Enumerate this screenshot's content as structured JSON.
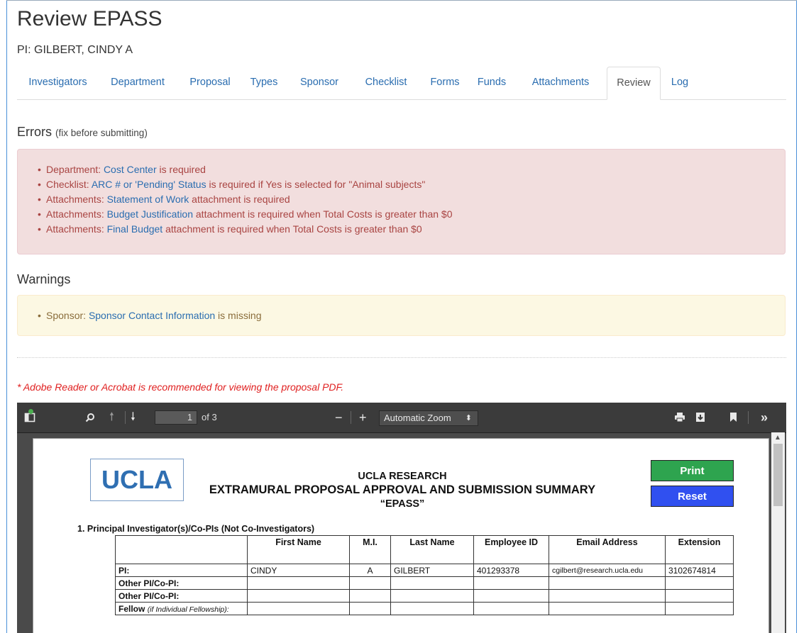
{
  "header": {
    "title": "Review EPASS",
    "pi_line": "PI: GILBERT, CINDY A"
  },
  "tabs": [
    {
      "label": "Investigators"
    },
    {
      "label": "Department"
    },
    {
      "label": "Proposal"
    },
    {
      "label": "Types"
    },
    {
      "label": "Sponsor"
    },
    {
      "label": "Checklist"
    },
    {
      "label": "Forms"
    },
    {
      "label": "Funds"
    },
    {
      "label": "Attachments"
    },
    {
      "label": "Review",
      "active": true
    },
    {
      "label": "Log"
    }
  ],
  "errors": {
    "heading": "Errors",
    "subheading": "(fix before submitting)",
    "items": [
      {
        "prefix": "Department: ",
        "link": "Cost Center",
        "suffix": " is required"
      },
      {
        "prefix": "Checklist: ",
        "link": "ARC # or 'Pending' Status",
        "suffix": " is required if Yes is selected for \"Animal subjects\""
      },
      {
        "prefix": "Attachments: ",
        "link": "Statement of Work",
        "suffix": " attachment is required"
      },
      {
        "prefix": "Attachments: ",
        "link": "Budget Justification",
        "suffix": " attachment is required when Total Costs is greater than $0"
      },
      {
        "prefix": "Attachments: ",
        "link": "Final Budget",
        "suffix": " attachment is required when Total Costs is greater than $0"
      }
    ]
  },
  "warnings": {
    "heading": "Warnings",
    "items": [
      {
        "prefix": "Sponsor: ",
        "link": "Sponsor Contact Information",
        "suffix": " is missing"
      }
    ]
  },
  "pdf_note": "* Adobe Reader or Acrobat is recommended for viewing the proposal PDF.",
  "viewer": {
    "page_number": "1",
    "page_of": "of 3",
    "zoom": "Automatic Zoom",
    "icons": {
      "sidebar": "sidebar-toggle-icon",
      "search": "search-icon",
      "prev": "arrow-up-icon",
      "next": "arrow-down-icon",
      "zoom_out": "minus-icon",
      "zoom_in": "plus-icon",
      "print": "print-icon",
      "download": "download-icon",
      "bookmark": "bookmark-icon",
      "more": "double-chevron-right-icon"
    }
  },
  "document": {
    "logo_text": "UCLA",
    "title_line1": "UCLA RESEARCH",
    "title_line2": "EXTRAMURAL PROPOSAL APPROVAL AND SUBMISSION SUMMARY",
    "title_line3": "“EPASS”",
    "print_label": "Print",
    "reset_label": "Reset",
    "section1_label": "1.   Principal Investigator(s)/Co-PIs (Not Co-Investigators)",
    "table": {
      "headers": [
        "First Name",
        "M.I.",
        "Last Name",
        "Employee ID",
        "Email Address",
        "Extension"
      ],
      "rows": [
        {
          "label": "PI:",
          "cells": [
            "CINDY",
            "A",
            "GILBERT",
            "401293378",
            "cgilbert@research.ucla.edu",
            "3102674814"
          ]
        },
        {
          "label": "Other PI/Co-PI:",
          "cells": [
            "",
            "",
            "",
            "",
            "",
            ""
          ]
        },
        {
          "label": "Other PI/Co-PI:",
          "cells": [
            "",
            "",
            "",
            "",
            "",
            ""
          ]
        },
        {
          "label": "Fellow",
          "label_note": "(if Individual Fellowship):",
          "cells": [
            "",
            "",
            "",
            "",
            "",
            ""
          ]
        }
      ]
    }
  },
  "colors": {
    "link": "#2a6db0",
    "error_bg": "#f2dede",
    "error_text": "#a94442",
    "warning_bg": "#fcf8e3",
    "warning_text": "#8a6d3b",
    "note_red": "#e02020",
    "print_green": "#2ea44f",
    "reset_blue": "#3050f0"
  }
}
